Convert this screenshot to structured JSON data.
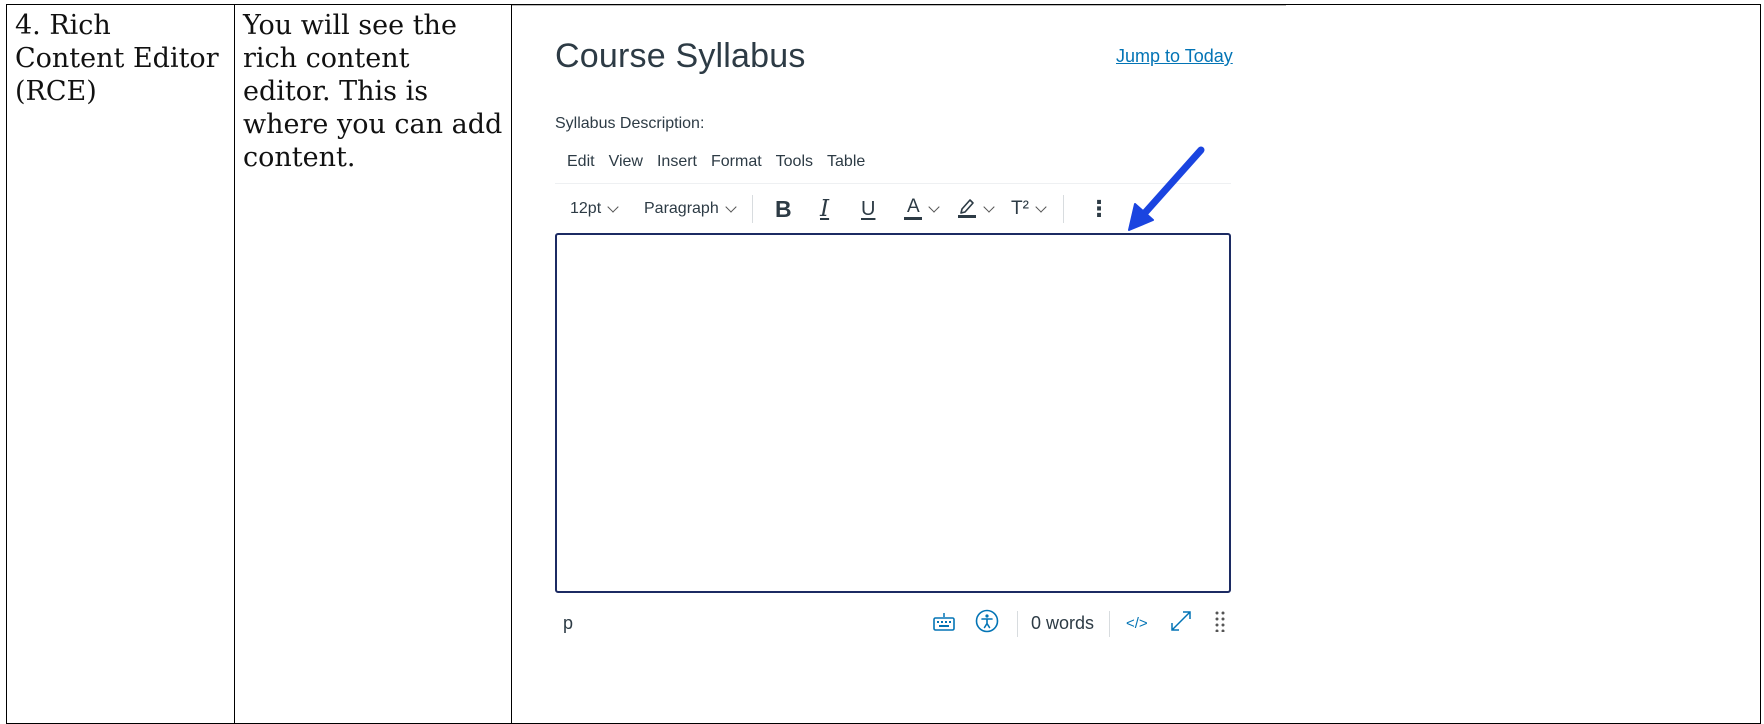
{
  "table": {
    "row": {
      "step": "4. Rich Content Editor (RCE)",
      "description": "You will see the rich content editor. This is where you can add content."
    }
  },
  "screenshot": {
    "page_title": "Course Syllabus",
    "jump_link": "Jump to Today",
    "description_label": "Syllabus Description:",
    "menu": [
      "Edit",
      "View",
      "Insert",
      "Format",
      "Tools",
      "Table"
    ],
    "toolbar": {
      "font_size": "12pt",
      "block_format": "Paragraph",
      "bold": "B",
      "italic": "I",
      "underline": "U",
      "text_color": "A",
      "superscript": "T²",
      "more": "⋮"
    },
    "statusbar": {
      "path": "p",
      "word_count": "0 words",
      "html_toggle": "</>"
    },
    "colors": {
      "link": "#0374b5",
      "editor_border": "#1c2b63",
      "annotation_arrow": "#1a44e0"
    }
  }
}
